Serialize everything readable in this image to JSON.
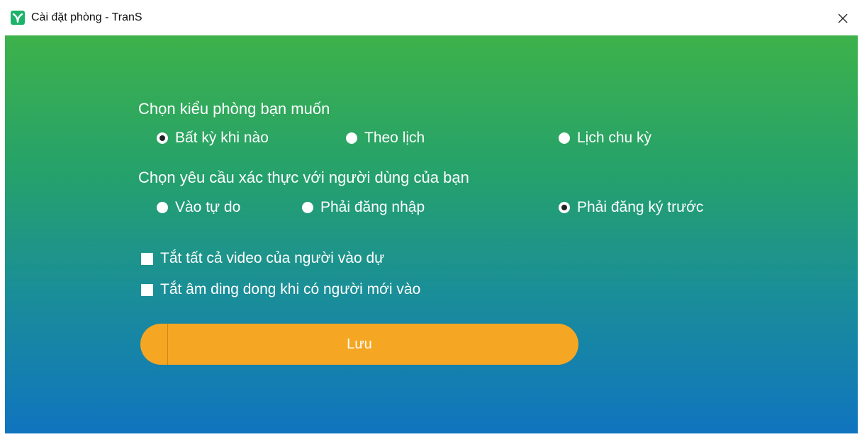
{
  "window": {
    "title": "Cài đặt phòng - TranS",
    "close_glyph": "✕",
    "app_icon": "trans-app-icon",
    "accent_color": "#f5a623"
  },
  "room_type": {
    "label": "Chọn kiểu phòng bạn muốn",
    "options": [
      {
        "label": "Bất kỳ khi nào",
        "checked": true
      },
      {
        "label": "Theo lịch",
        "checked": false
      },
      {
        "label": "Lịch chu kỳ",
        "checked": false
      }
    ]
  },
  "auth": {
    "label": "Chọn yêu cầu xác thực với người dùng của bạn",
    "options": [
      {
        "label": "Vào tự do",
        "checked": false
      },
      {
        "label": "Phải đăng nhập",
        "checked": false
      },
      {
        "label": "Phải đăng ký trước",
        "checked": true
      }
    ]
  },
  "checkboxes": [
    {
      "label": "Tắt tất cả video của người vào dự",
      "checked": false
    },
    {
      "label": "Tắt âm ding dong khi có người mới vào",
      "checked": false
    }
  ],
  "save_button": {
    "label": "Lưu"
  }
}
